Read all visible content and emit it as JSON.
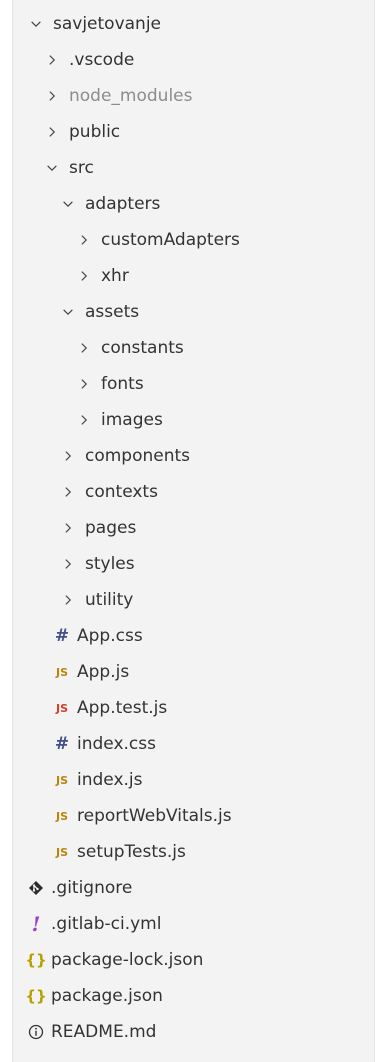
{
  "tree": {
    "root": {
      "label": "savjetovanje",
      "expanded": true,
      "icon": "chevron-down-icon"
    },
    "items": [
      {
        "label": ".vscode",
        "kind": "folder",
        "expanded": false
      },
      {
        "label": "node_modules",
        "kind": "folder",
        "expanded": false,
        "dimmed": true
      },
      {
        "label": "public",
        "kind": "folder",
        "expanded": false
      },
      {
        "label": "src",
        "kind": "folder",
        "expanded": true
      },
      {
        "label": "adapters",
        "kind": "folder",
        "expanded": true
      },
      {
        "label": "customAdapters",
        "kind": "folder",
        "expanded": false
      },
      {
        "label": "xhr",
        "kind": "folder",
        "expanded": false
      },
      {
        "label": "assets",
        "kind": "folder",
        "expanded": true
      },
      {
        "label": "constants",
        "kind": "folder",
        "expanded": false
      },
      {
        "label": "fonts",
        "kind": "folder",
        "expanded": false
      },
      {
        "label": "images",
        "kind": "folder",
        "expanded": false
      },
      {
        "label": "components",
        "kind": "folder",
        "expanded": false
      },
      {
        "label": "contexts",
        "kind": "folder",
        "expanded": false
      },
      {
        "label": "pages",
        "kind": "folder",
        "expanded": false
      },
      {
        "label": "styles",
        "kind": "folder",
        "expanded": false
      },
      {
        "label": "utility",
        "kind": "folder",
        "expanded": false
      },
      {
        "label": "App.css",
        "kind": "file",
        "icon": "css-hash-icon",
        "glyph": "#"
      },
      {
        "label": "App.js",
        "kind": "file",
        "icon": "js-icon",
        "glyph": "JS"
      },
      {
        "label": "App.test.js",
        "kind": "file",
        "icon": "js-test-icon",
        "glyph": "JS"
      },
      {
        "label": "index.css",
        "kind": "file",
        "icon": "css-hash-icon",
        "glyph": "#"
      },
      {
        "label": "index.js",
        "kind": "file",
        "icon": "js-icon",
        "glyph": "JS"
      },
      {
        "label": "reportWebVitals.js",
        "kind": "file",
        "icon": "js-icon",
        "glyph": "JS"
      },
      {
        "label": "setupTests.js",
        "kind": "file",
        "icon": "js-icon",
        "glyph": "JS"
      },
      {
        "label": ".gitignore",
        "kind": "file",
        "icon": "git-diamond-icon"
      },
      {
        "label": ".gitlab-ci.yml",
        "kind": "file",
        "icon": "yml-exclamation-icon",
        "glyph": "!"
      },
      {
        "label": "package-lock.json",
        "kind": "file",
        "icon": "json-braces-icon",
        "glyph": "{}"
      },
      {
        "label": "package.json",
        "kind": "file",
        "icon": "json-braces-icon",
        "glyph": "{}"
      },
      {
        "label": "README.md",
        "kind": "file",
        "icon": "info-icon"
      }
    ]
  },
  "colors": {
    "background": "#f3f3f3",
    "text": "#333333",
    "dimmed_text": "#8c8c8c",
    "css_icon": "#42518a",
    "js_icon": "#b8860b",
    "js_test_icon": "#d0402b",
    "json_icon": "#b8a000",
    "yml_icon": "#9b3fc9"
  }
}
